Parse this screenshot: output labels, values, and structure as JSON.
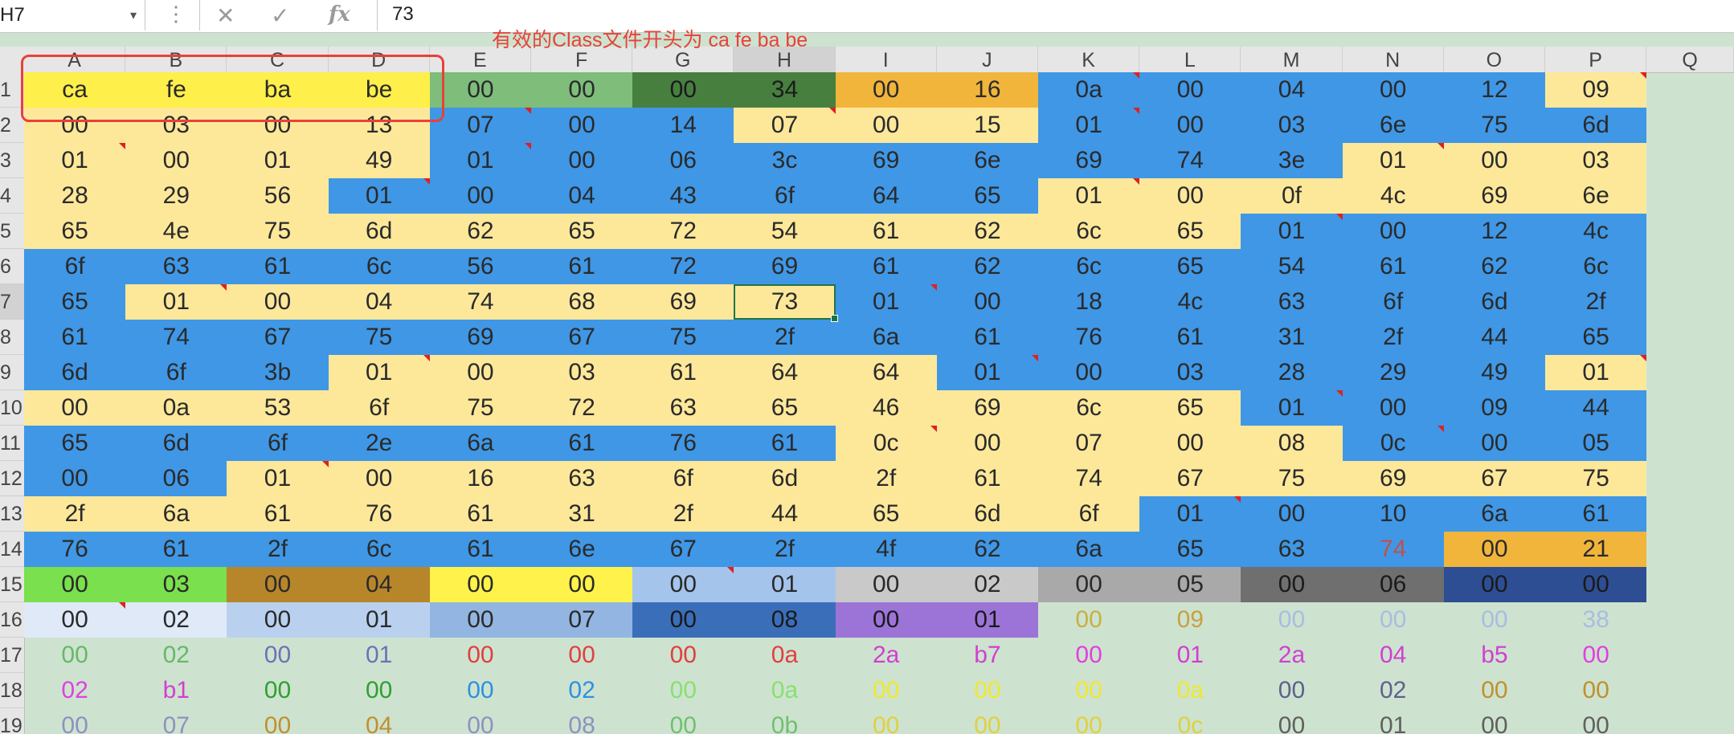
{
  "formula_bar": {
    "name_box": "H7",
    "name_box_arrow": "▾",
    "dots": "⋮",
    "cancel_glyph": "✕",
    "enter_glyph": "✓",
    "fx_glyph": "fx",
    "value": "73"
  },
  "annotation": {
    "text": "有效的Class文件开头为 ca fe ba be",
    "color": "#e8413a"
  },
  "selected_cell": "H7",
  "columns": [
    "A",
    "B",
    "C",
    "D",
    "E",
    "F",
    "G",
    "H",
    "I",
    "J",
    "K",
    "L",
    "M",
    "N",
    "O",
    "P",
    "Q"
  ],
  "rows": [
    "1",
    "2",
    "3",
    "4",
    "5",
    "6",
    "7",
    "8",
    "9",
    "10",
    "11",
    "12",
    "13",
    "14",
    "15",
    "16",
    "17",
    "18",
    "19"
  ],
  "palette": {
    "Y": "#fde89a",
    "B": "#3f97e6",
    "S": "#ffef4a",
    "E1": "#7ebd7a",
    "E2": "#477f3f",
    "OR": "#f1b53b",
    "GR": "#7ae04d",
    "BR": "#b8862a",
    "YL": "#fff24a",
    "LB": "#a5c4ec",
    "LG": "#c9c9c9",
    "MG": "#a9a9a9",
    "DG": "#6f6f6f",
    "NV": "#2e4e93",
    "PL": "#dfe9f8",
    "PB": "#b9d1ef",
    "MB": "#93b5e1",
    "DB": "#3a6eb9",
    "PU": "#9c74d8"
  },
  "grid": [
    [
      [
        "ca",
        "S"
      ],
      [
        "fe",
        "S"
      ],
      [
        "ba",
        "S"
      ],
      [
        "be",
        "S"
      ],
      [
        "00",
        "E1"
      ],
      [
        "00",
        "E1"
      ],
      [
        "00",
        "E2"
      ],
      [
        "34",
        "E2"
      ],
      [
        "00",
        "OR"
      ],
      [
        "16",
        "OR"
      ],
      [
        "0a",
        "B",
        1
      ],
      [
        "00",
        "B"
      ],
      [
        "04",
        "B"
      ],
      [
        "00",
        "B"
      ],
      [
        "12",
        "B"
      ],
      [
        "09",
        "Y",
        1
      ]
    ],
    [
      [
        "00",
        "Y"
      ],
      [
        "03",
        "Y"
      ],
      [
        "00",
        "Y"
      ],
      [
        "13",
        "Y"
      ],
      [
        "07",
        "B",
        1
      ],
      [
        "00",
        "B"
      ],
      [
        "14",
        "B"
      ],
      [
        "07",
        "Y",
        1
      ],
      [
        "00",
        "Y"
      ],
      [
        "15",
        "Y"
      ],
      [
        "01",
        "B",
        1
      ],
      [
        "00",
        "B"
      ],
      [
        "03",
        "B"
      ],
      [
        "6e",
        "B"
      ],
      [
        "75",
        "B"
      ],
      [
        "6d",
        "B"
      ]
    ],
    [
      [
        "01",
        "Y",
        1
      ],
      [
        "00",
        "Y"
      ],
      [
        "01",
        "Y"
      ],
      [
        "49",
        "Y"
      ],
      [
        "01",
        "B",
        1
      ],
      [
        "00",
        "B"
      ],
      [
        "06",
        "B"
      ],
      [
        "3c",
        "B"
      ],
      [
        "69",
        "B"
      ],
      [
        "6e",
        "B"
      ],
      [
        "69",
        "B"
      ],
      [
        "74",
        "B"
      ],
      [
        "3e",
        "B"
      ],
      [
        "01",
        "Y",
        1
      ],
      [
        "00",
        "Y"
      ],
      [
        "03",
        "Y"
      ]
    ],
    [
      [
        "28",
        "Y"
      ],
      [
        "29",
        "Y"
      ],
      [
        "56",
        "Y"
      ],
      [
        "01",
        "B",
        1
      ],
      [
        "00",
        "B"
      ],
      [
        "04",
        "B"
      ],
      [
        "43",
        "B"
      ],
      [
        "6f",
        "B"
      ],
      [
        "64",
        "B"
      ],
      [
        "65",
        "B"
      ],
      [
        "01",
        "Y",
        1
      ],
      [
        "00",
        "Y"
      ],
      [
        "0f",
        "Y"
      ],
      [
        "4c",
        "Y"
      ],
      [
        "69",
        "Y"
      ],
      [
        "6e",
        "Y"
      ]
    ],
    [
      [
        "65",
        "Y"
      ],
      [
        "4e",
        "Y"
      ],
      [
        "75",
        "Y"
      ],
      [
        "6d",
        "Y"
      ],
      [
        "62",
        "Y"
      ],
      [
        "65",
        "Y"
      ],
      [
        "72",
        "Y"
      ],
      [
        "54",
        "Y"
      ],
      [
        "61",
        "Y"
      ],
      [
        "62",
        "Y"
      ],
      [
        "6c",
        "Y"
      ],
      [
        "65",
        "Y"
      ],
      [
        "01",
        "B",
        1
      ],
      [
        "00",
        "B"
      ],
      [
        "12",
        "B"
      ],
      [
        "4c",
        "B"
      ]
    ],
    [
      [
        "6f",
        "B"
      ],
      [
        "63",
        "B"
      ],
      [
        "61",
        "B"
      ],
      [
        "6c",
        "B"
      ],
      [
        "56",
        "B"
      ],
      [
        "61",
        "B"
      ],
      [
        "72",
        "B"
      ],
      [
        "69",
        "B"
      ],
      [
        "61",
        "B"
      ],
      [
        "62",
        "B"
      ],
      [
        "6c",
        "B"
      ],
      [
        "65",
        "B"
      ],
      [
        "54",
        "B"
      ],
      [
        "61",
        "B"
      ],
      [
        "62",
        "B"
      ],
      [
        "6c",
        "B"
      ]
    ],
    [
      [
        "65",
        "B"
      ],
      [
        "01",
        "Y",
        1
      ],
      [
        "00",
        "Y"
      ],
      [
        "04",
        "Y"
      ],
      [
        "74",
        "Y"
      ],
      [
        "68",
        "Y"
      ],
      [
        "69",
        "Y"
      ],
      [
        "73",
        "Y"
      ],
      [
        "01",
        "B",
        1
      ],
      [
        "00",
        "B"
      ],
      [
        "18",
        "B"
      ],
      [
        "4c",
        "B"
      ],
      [
        "63",
        "B"
      ],
      [
        "6f",
        "B"
      ],
      [
        "6d",
        "B"
      ],
      [
        "2f",
        "B"
      ]
    ],
    [
      [
        "61",
        "B"
      ],
      [
        "74",
        "B"
      ],
      [
        "67",
        "B"
      ],
      [
        "75",
        "B"
      ],
      [
        "69",
        "B"
      ],
      [
        "67",
        "B"
      ],
      [
        "75",
        "B"
      ],
      [
        "2f",
        "B"
      ],
      [
        "6a",
        "B"
      ],
      [
        "61",
        "B"
      ],
      [
        "76",
        "B"
      ],
      [
        "61",
        "B"
      ],
      [
        "31",
        "B"
      ],
      [
        "2f",
        "B"
      ],
      [
        "44",
        "B"
      ],
      [
        "65",
        "B"
      ]
    ],
    [
      [
        "6d",
        "B"
      ],
      [
        "6f",
        "B"
      ],
      [
        "3b",
        "B"
      ],
      [
        "01",
        "Y",
        1
      ],
      [
        "00",
        "Y"
      ],
      [
        "03",
        "Y"
      ],
      [
        "61",
        "Y"
      ],
      [
        "64",
        "Y"
      ],
      [
        "64",
        "Y"
      ],
      [
        "01",
        "B",
        1
      ],
      [
        "00",
        "B"
      ],
      [
        "03",
        "B"
      ],
      [
        "28",
        "B"
      ],
      [
        "29",
        "B"
      ],
      [
        "49",
        "B"
      ],
      [
        "01",
        "Y",
        1
      ]
    ],
    [
      [
        "00",
        "Y"
      ],
      [
        "0a",
        "Y"
      ],
      [
        "53",
        "Y"
      ],
      [
        "6f",
        "Y"
      ],
      [
        "75",
        "Y"
      ],
      [
        "72",
        "Y"
      ],
      [
        "63",
        "Y"
      ],
      [
        "65",
        "Y"
      ],
      [
        "46",
        "Y"
      ],
      [
        "69",
        "Y"
      ],
      [
        "6c",
        "Y"
      ],
      [
        "65",
        "Y"
      ],
      [
        "01",
        "B",
        1
      ],
      [
        "00",
        "B"
      ],
      [
        "09",
        "B"
      ],
      [
        "44",
        "B"
      ]
    ],
    [
      [
        "65",
        "B"
      ],
      [
        "6d",
        "B"
      ],
      [
        "6f",
        "B"
      ],
      [
        "2e",
        "B"
      ],
      [
        "6a",
        "B"
      ],
      [
        "61",
        "B"
      ],
      [
        "76",
        "B"
      ],
      [
        "61",
        "B"
      ],
      [
        "0c",
        "Y",
        1
      ],
      [
        "00",
        "Y"
      ],
      [
        "07",
        "Y"
      ],
      [
        "00",
        "Y"
      ],
      [
        "08",
        "Y"
      ],
      [
        "0c",
        "B",
        1
      ],
      [
        "00",
        "B"
      ],
      [
        "05",
        "B"
      ]
    ],
    [
      [
        "00",
        "B"
      ],
      [
        "06",
        "B"
      ],
      [
        "01",
        "Y",
        1
      ],
      [
        "00",
        "Y"
      ],
      [
        "16",
        "Y"
      ],
      [
        "63",
        "Y"
      ],
      [
        "6f",
        "Y"
      ],
      [
        "6d",
        "Y"
      ],
      [
        "2f",
        "Y"
      ],
      [
        "61",
        "Y"
      ],
      [
        "74",
        "Y"
      ],
      [
        "67",
        "Y"
      ],
      [
        "75",
        "Y"
      ],
      [
        "69",
        "Y"
      ],
      [
        "67",
        "Y"
      ],
      [
        "75",
        "Y"
      ]
    ],
    [
      [
        "2f",
        "Y"
      ],
      [
        "6a",
        "Y"
      ],
      [
        "61",
        "Y"
      ],
      [
        "76",
        "Y"
      ],
      [
        "61",
        "Y"
      ],
      [
        "31",
        "Y"
      ],
      [
        "2f",
        "Y"
      ],
      [
        "44",
        "Y"
      ],
      [
        "65",
        "Y"
      ],
      [
        "6d",
        "Y"
      ],
      [
        "6f",
        "Y"
      ],
      [
        "01",
        "B",
        1
      ],
      [
        "00",
        "B"
      ],
      [
        "10",
        "B"
      ],
      [
        "6a",
        "B"
      ],
      [
        "61",
        "B"
      ]
    ],
    [
      [
        "76",
        "B"
      ],
      [
        "61",
        "B"
      ],
      [
        "2f",
        "B"
      ],
      [
        "6c",
        "B"
      ],
      [
        "61",
        "B"
      ],
      [
        "6e",
        "B"
      ],
      [
        "67",
        "B"
      ],
      [
        "2f",
        "B"
      ],
      [
        "4f",
        "B"
      ],
      [
        "62",
        "B"
      ],
      [
        "6a",
        "B"
      ],
      [
        "65",
        "B"
      ],
      [
        "63",
        "B"
      ],
      [
        "74",
        "B",
        "#c0504d"
      ],
      [
        "00",
        "OR"
      ],
      [
        "21",
        "OR"
      ]
    ],
    [
      [
        "00",
        "GR"
      ],
      [
        "03",
        "GR"
      ],
      [
        "00",
        "BR"
      ],
      [
        "04",
        "BR"
      ],
      [
        "00",
        "YL"
      ],
      [
        "00",
        "YL"
      ],
      [
        "00",
        "LB",
        1
      ],
      [
        "01",
        "LB"
      ],
      [
        "00",
        "LG"
      ],
      [
        "02",
        "LG"
      ],
      [
        "00",
        "MG"
      ],
      [
        "05",
        "MG"
      ],
      [
        "00",
        "DG"
      ],
      [
        "06",
        "DG"
      ],
      [
        "00",
        "NV"
      ],
      [
        "00",
        "NV"
      ]
    ],
    [
      [
        "00",
        "PL",
        1
      ],
      [
        "02",
        "PL"
      ],
      [
        "00",
        "PB"
      ],
      [
        "01",
        "PB"
      ],
      [
        "00",
        "MB"
      ],
      [
        "07",
        "MB"
      ],
      [
        "00",
        "DB"
      ],
      [
        "08",
        "DB"
      ],
      [
        "00",
        "PU"
      ],
      [
        "01",
        "PU"
      ],
      [
        "00",
        "",
        "#c8b040"
      ],
      [
        "09",
        "",
        "#c8a040"
      ],
      [
        "00",
        "",
        "#a8bde0"
      ],
      [
        "00",
        "",
        "#a8bde0"
      ],
      [
        "00",
        "",
        "#a8bde0"
      ],
      [
        "38",
        "",
        "#a8bde0"
      ]
    ],
    [
      [
        "00",
        "",
        "#68b868"
      ],
      [
        "02",
        "",
        "#68b868"
      ],
      [
        "00",
        "",
        "#7070b8"
      ],
      [
        "01",
        "",
        "#7070b8"
      ],
      [
        "00",
        "",
        "#e04040"
      ],
      [
        "00",
        "",
        "#e04040"
      ],
      [
        "00",
        "",
        "#e04040"
      ],
      [
        "0a",
        "",
        "#e04040"
      ],
      [
        "2a",
        "",
        "#d040d0"
      ],
      [
        "b7",
        "",
        "#d040d0"
      ],
      [
        "00",
        "",
        "#e040e0"
      ],
      [
        "01",
        "",
        "#d040d0"
      ],
      [
        "2a",
        "",
        "#d040d0"
      ],
      [
        "04",
        "",
        "#d040d0"
      ],
      [
        "b5",
        "",
        "#d040d0"
      ],
      [
        "00",
        "",
        "#e040e0"
      ]
    ],
    [
      [
        "02",
        "",
        "#e040e0"
      ],
      [
        "b1",
        "",
        "#d040d0"
      ],
      [
        "00",
        "",
        "#30a030"
      ],
      [
        "00",
        "",
        "#30a030"
      ],
      [
        "00",
        "",
        "#3090e0"
      ],
      [
        "02",
        "",
        "#3090e0"
      ],
      [
        "00",
        "",
        "#88e070"
      ],
      [
        "0a",
        "",
        "#88e070"
      ],
      [
        "00",
        "",
        "#f0e830"
      ],
      [
        "00",
        "",
        "#f0e830"
      ],
      [
        "00",
        "",
        "#f0e830"
      ],
      [
        "0a",
        "",
        "#f0e830"
      ],
      [
        "00",
        "",
        "#606090"
      ],
      [
        "02",
        "",
        "#606090"
      ],
      [
        "00",
        "",
        "#c09030"
      ],
      [
        "00",
        "",
        "#c09030"
      ]
    ],
    [
      [
        "00",
        "",
        "#9090c0"
      ],
      [
        "07",
        "",
        "#9090c0"
      ],
      [
        "00",
        "",
        "#c09030"
      ],
      [
        "04",
        "",
        "#c09030"
      ],
      [
        "00",
        "",
        "#9090c0"
      ],
      [
        "08",
        "",
        "#9090c0"
      ],
      [
        "00",
        "",
        "#70c070"
      ],
      [
        "0b",
        "",
        "#70c070"
      ],
      [
        "00",
        "",
        "#e0d040"
      ],
      [
        "00",
        "",
        "#e0d040"
      ],
      [
        "00",
        "",
        "#e0d040"
      ],
      [
        "0c",
        "",
        "#e0d040"
      ],
      [
        "00",
        "",
        "#606060"
      ],
      [
        "01",
        "",
        "#606060"
      ],
      [
        "00",
        "",
        "#606060"
      ],
      [
        "00",
        "",
        "#606060"
      ]
    ]
  ]
}
